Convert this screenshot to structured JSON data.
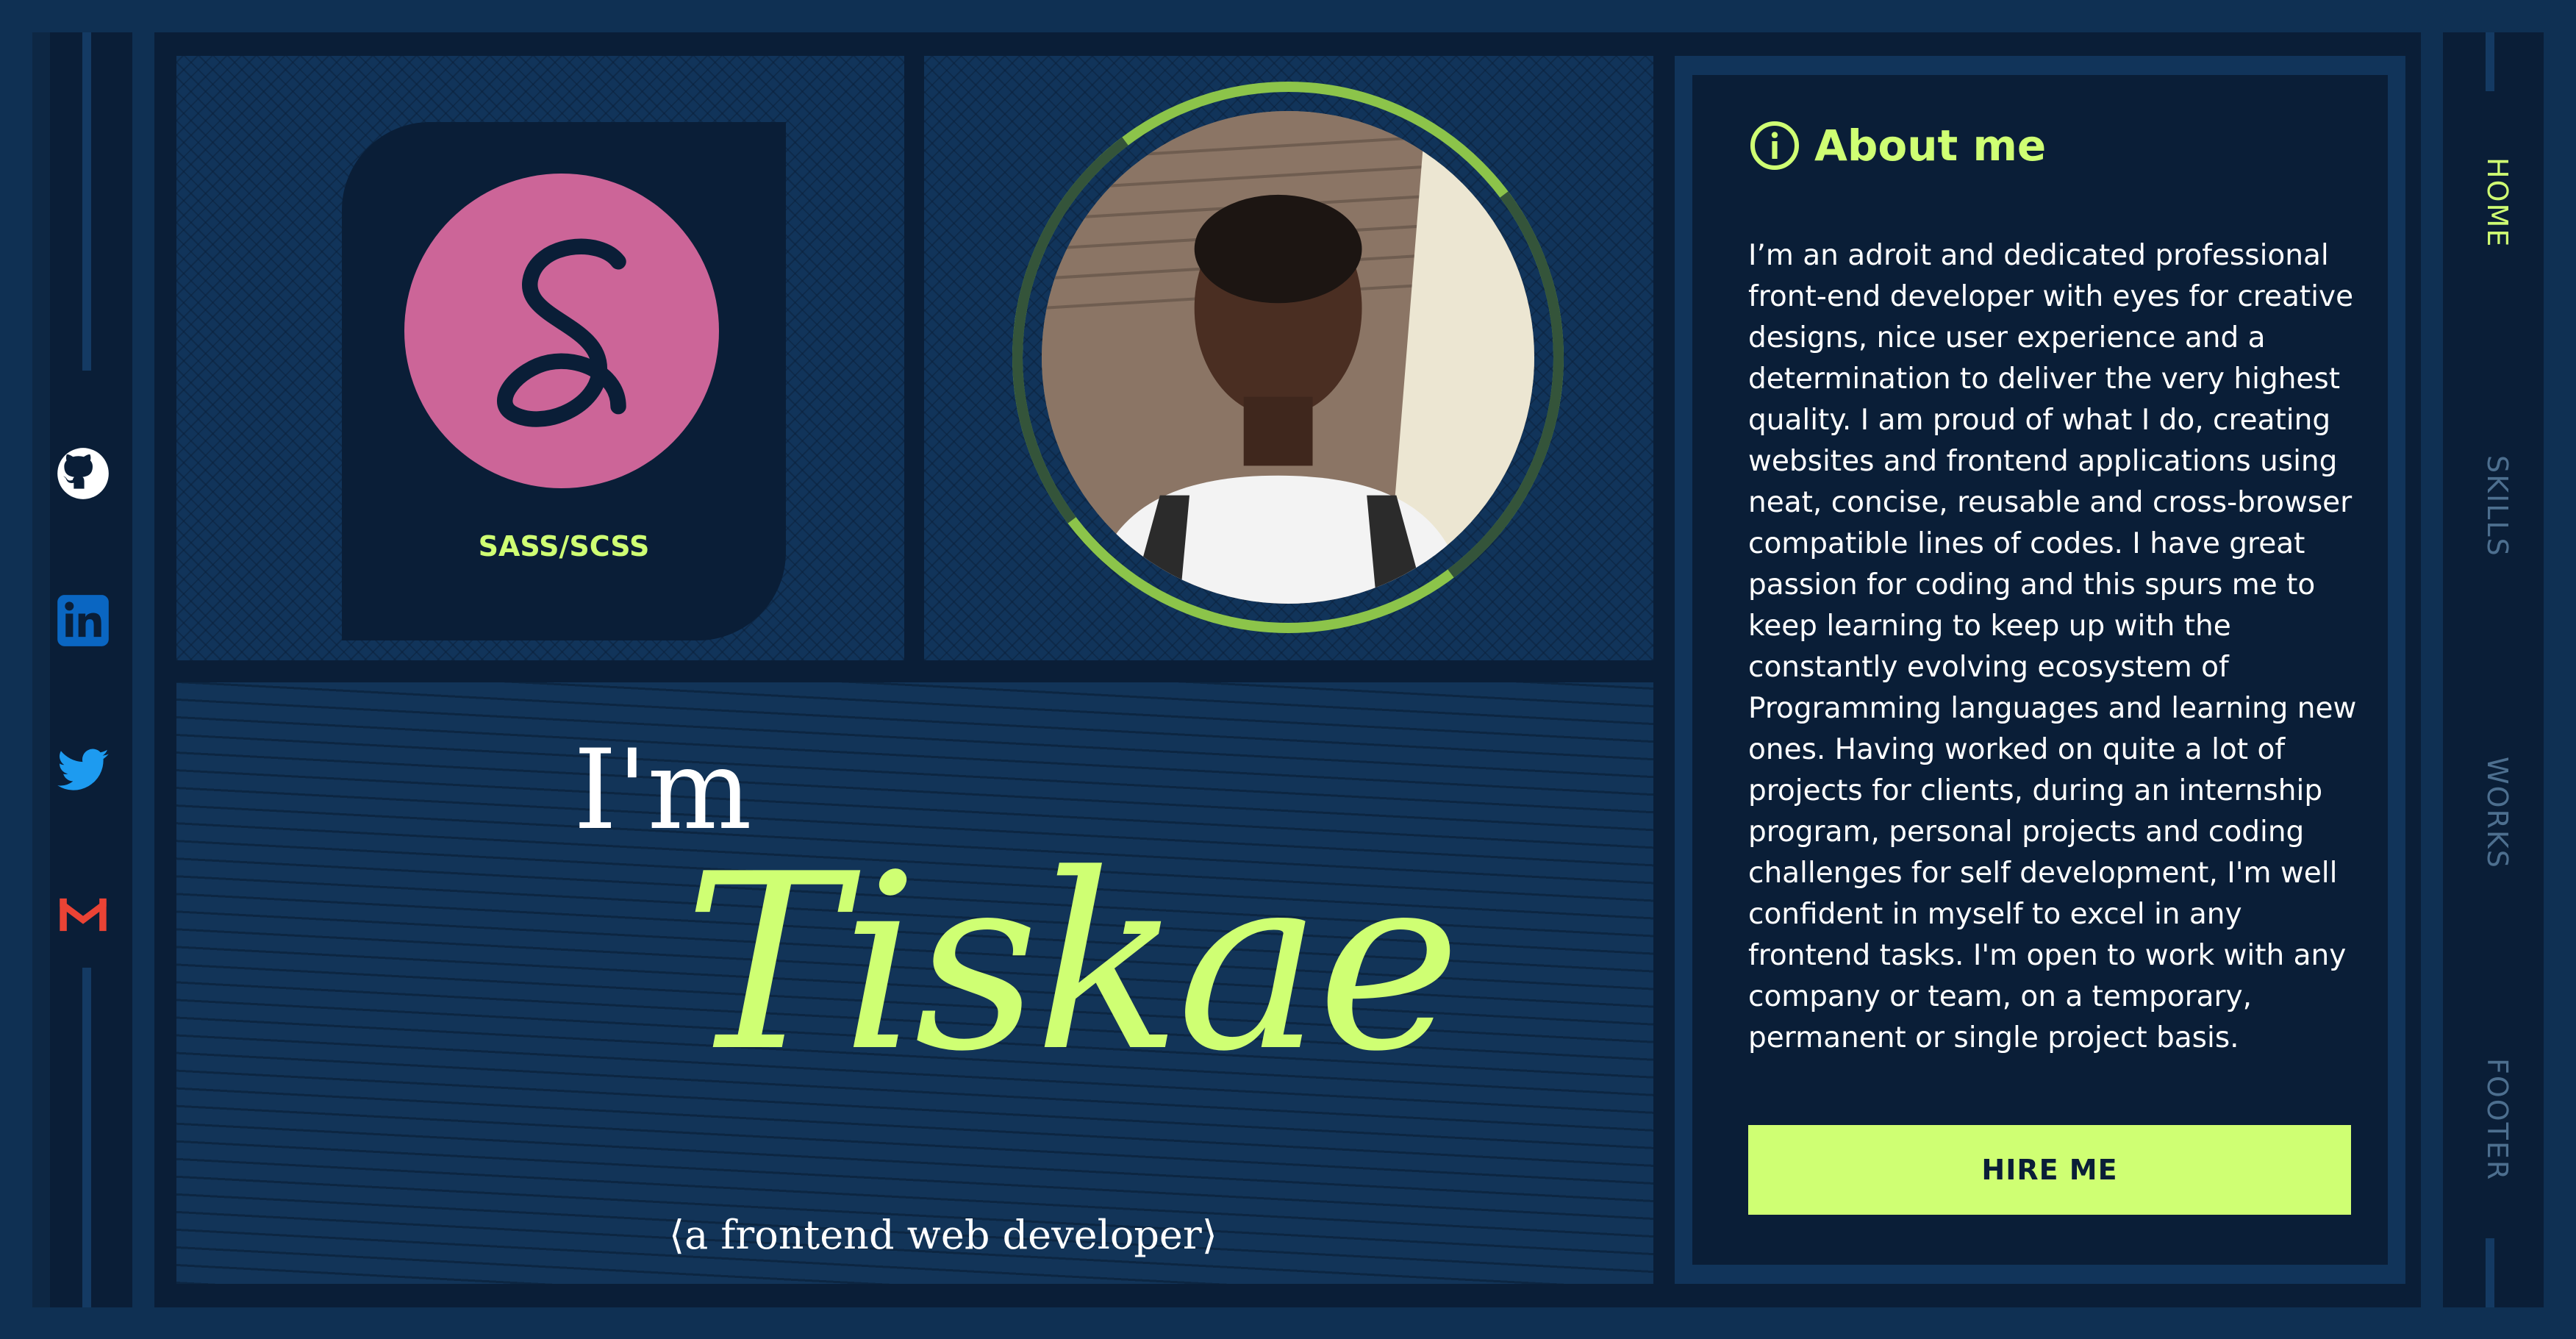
{
  "social": {
    "items": [
      {
        "name": "github"
      },
      {
        "name": "linkedin"
      },
      {
        "name": "twitter"
      },
      {
        "name": "gmail"
      }
    ]
  },
  "nav": {
    "items": [
      {
        "label": "HOME",
        "active": true
      },
      {
        "label": "SKILLS",
        "active": false
      },
      {
        "label": "WORKS",
        "active": false
      },
      {
        "label": "FOOTER",
        "active": false
      }
    ]
  },
  "skill": {
    "label": "SASS/SCSS",
    "logo_letter": "S",
    "color": "#cc6598"
  },
  "intro": {
    "prefix": "I'm",
    "name": "Tiskae",
    "role": "⟨a frontend web developer⟩"
  },
  "about": {
    "title": "About me",
    "text": "I’m an adroit and dedicated professional front-end developer with eyes for creative designs, nice user experience and a determination to deliver the very highest quality. I am proud of what I do, creating websites and frontend applications using neat, concise, reusable and cross-browser compatible lines of codes. I have great passion for coding and this spurs me to keep learning to keep up with the constantly evolving ecosystem of Programming languages and learning new ones. Having worked on quite a lot of projects for clients, during an internship program, personal projects and coding challenges for self development, I'm well confident in myself to excel in any frontend tasks. I'm open to work with any company or team, on a temporary, permanent or single project basis.",
    "button_label": "HIRE ME"
  },
  "colors": {
    "accent": "#cfff73",
    "background": "#0f3053",
    "panel": "#0a1e37"
  }
}
